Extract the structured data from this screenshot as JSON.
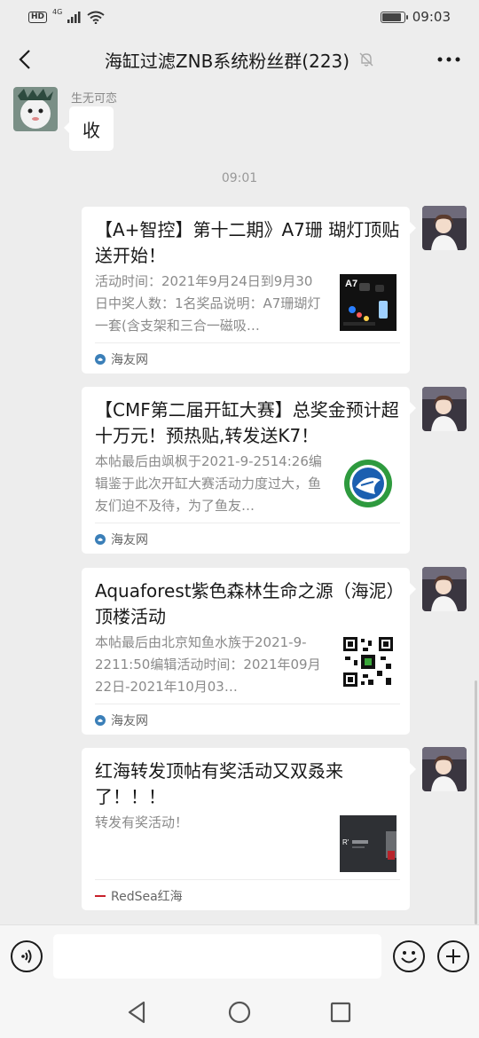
{
  "status_bar": {
    "hd_label": "HD",
    "network_label": "4G",
    "time": "09:03",
    "battery_level": 0.9
  },
  "header": {
    "title": "海缸过滤ZNB系统粉丝群(223)",
    "back_icon": "chevron-left-icon",
    "mute_icon": "bell-off-icon",
    "more_icon": "more-dots-icon"
  },
  "messages": {
    "first": {
      "sender": "生无可恋",
      "text": "收"
    },
    "timestamp": "09:01",
    "cards": [
      {
        "title": "【A+智控】第十二期》A7珊 瑚灯顶贴送开始！",
        "desc": "活动时间：2021年9月24日到9月30日中奖人数：1名奖品说明：A7珊瑚灯一套(含支架和三合一磁吸…",
        "source": "海友网",
        "thumb_label": "A7"
      },
      {
        "title": "【CMF第二届开缸大赛】总奖金预计超十万元！预热贴,转发送K7！",
        "desc": "本帖最后由飒枫于2021-9-2514:26编辑鉴于此次开缸大赛活动力度过大，鱼友们迫不及待，为了鱼友…",
        "source": "海友网"
      },
      {
        "title": "Aquaforest紫色森林生命之源（海泥）顶楼活动",
        "desc": "本帖最后由北京知鱼水族于2021-9-2211:50编辑活动时间：2021年09月22日-2021年10月03…",
        "source": "海友网"
      },
      {
        "title": "红海转发顶帖有奖活动又双叒来了！！！",
        "desc": "转发有奖活动！",
        "source": "RedSea红海",
        "thumb_label": "R'"
      }
    ]
  },
  "input_bar": {
    "placeholder": "",
    "voice_icon": "voice-icon",
    "emoji_icon": "emoji-icon",
    "plus_icon": "plus-icon"
  },
  "nav_bar": {
    "back_icon": "nav-back-triangle-icon",
    "home_icon": "nav-home-circle-icon",
    "recent_icon": "nav-recent-square-icon"
  }
}
